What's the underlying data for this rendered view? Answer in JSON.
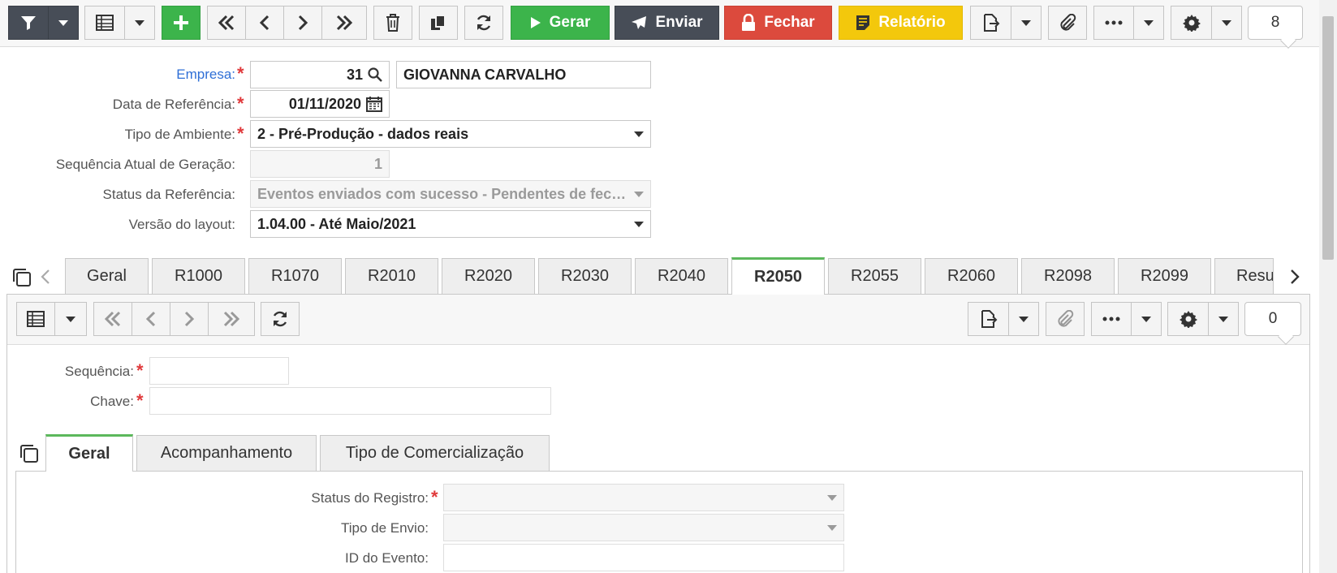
{
  "toolbar": {
    "gerar_label": "Gerar",
    "enviar_label": "Enviar",
    "fechar_label": "Fechar",
    "relatorio_label": "Relatório",
    "record_count": "8",
    "icons": [
      "filter-icon",
      "grid-icon",
      "plus-icon",
      "first-icon",
      "prev-icon",
      "next-icon",
      "last-icon",
      "trash-icon",
      "copy-icon",
      "refresh-icon",
      "play-icon",
      "send-icon",
      "lock-icon",
      "report-icon",
      "export-icon",
      "attach-icon",
      "more-icon",
      "gear-icon"
    ]
  },
  "form": {
    "empresa": {
      "label": "Empresa:",
      "code": "31",
      "name": "GIOVANNA CARVALHO"
    },
    "data_referencia": {
      "label": "Data de Referência:",
      "value": "01/11/2020"
    },
    "tipo_ambiente": {
      "label": "Tipo de Ambiente:",
      "value": "2 - Pré-Produção - dados reais"
    },
    "sequencia_atual": {
      "label": "Sequência Atual de Geração:",
      "value": "1"
    },
    "status_referencia": {
      "label": "Status da Referência:",
      "value": "Eventos enviados com sucesso - Pendentes de fechamento"
    },
    "versao_layout": {
      "label": "Versão do layout:",
      "value": "1.04.00 - Até Maio/2021"
    }
  },
  "tabs": [
    "Geral",
    "R1000",
    "R1070",
    "R2010",
    "R2020",
    "R2030",
    "R2040",
    "R2050",
    "R2055",
    "R2060",
    "R2098",
    "R2099",
    "Resu"
  ],
  "active_tab": "R2050",
  "subtoolbar": {
    "record_count": "0"
  },
  "subform": {
    "sequencia": {
      "label": "Sequência:",
      "value": ""
    },
    "chave": {
      "label": "Chave:",
      "value": ""
    }
  },
  "subtabs": [
    "Geral",
    "Acompanhamento",
    "Tipo de Comercialização"
  ],
  "active_subtab": "Geral",
  "geral": {
    "status_registro": {
      "label": "Status do Registro:",
      "value": ""
    },
    "tipo_envio": {
      "label": "Tipo de Envio:",
      "value": ""
    },
    "id_evento": {
      "label": "ID do Evento:",
      "value": ""
    }
  },
  "colors": {
    "green": "#3cb44b",
    "dark": "#474d57",
    "red": "#dc4a3d",
    "yellow": "#f3c80c",
    "link_blue": "#2f6fd6",
    "required": "#e0393b",
    "active_tab_border": "#5cb85c"
  }
}
